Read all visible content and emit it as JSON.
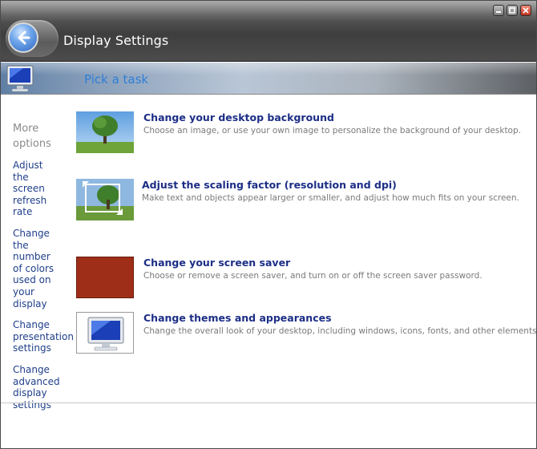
{
  "window": {
    "title": "Display Settings",
    "controls": [
      "minimize-icon",
      "maximize-icon",
      "close-icon"
    ]
  },
  "taskbar": {
    "heading": "Pick a task",
    "icon": "monitor-icon"
  },
  "sidebar": {
    "heading": "More options",
    "links": [
      "Adjust the screen refresh rate",
      "Change the number of colors used on your display",
      "Change presentation settings",
      "Change advanced display settings"
    ]
  },
  "tasks": [
    {
      "title": "Change your desktop background",
      "description": "Choose an image, or use your own image to personalize the background of your desktop.",
      "icon": "tree-landscape-thumbnail"
    },
    {
      "title": "Adjust the scaling factor (resolution and dpi)",
      "description": "Make text and objects appear larger or smaller, and adjust how much fits on your screen.",
      "icon": "scaling-thumbnail"
    },
    {
      "title": "Change your screen saver",
      "description": "Choose or remove a screen saver, and turn on or off the screen saver password.",
      "icon": "screensaver-thumbnail",
      "color": "#9e2e18"
    },
    {
      "title": "Change themes and appearances",
      "description": "Change the overall look of your desktop, including windows, icons, fonts, and other elements.",
      "icon": "monitor-thumbnail"
    }
  ],
  "colors": {
    "link": "#1f3f8a",
    "task_title": "#1c2e86",
    "pick_task": "#2e7fd6",
    "muted": "#8a8a8a"
  }
}
